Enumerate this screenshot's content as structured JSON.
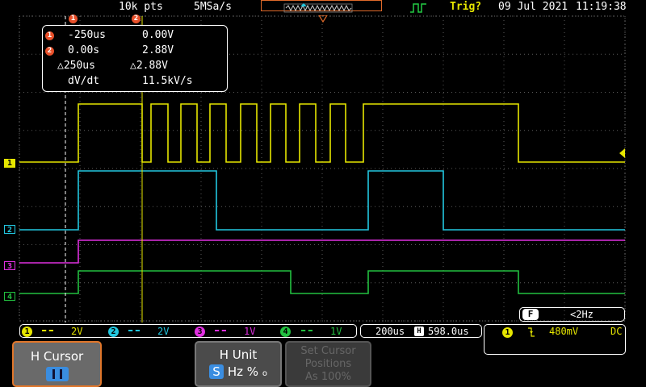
{
  "top": {
    "record_length": "10k pts",
    "sample_rate": "5MSa/s",
    "trigger_status": "Trig?",
    "date": "09 Jul 2021",
    "time": "11:19:38"
  },
  "cursor_readout": {
    "c1_marker": "1",
    "c2_marker": "2",
    "c1_time": "-250us",
    "c1_volt": "0.00V",
    "c2_time": "0.00s",
    "c2_volt": "2.88V",
    "delta_time": "△250us",
    "delta_volt": "△2.88V",
    "dvdt_label": "dV/dt",
    "dvdt_value": "11.5kV/s"
  },
  "channels": [
    {
      "id": "1",
      "scale": "2V",
      "color": "#e6e600"
    },
    {
      "id": "2",
      "scale": "2V",
      "color": "#22c7e0"
    },
    {
      "id": "3",
      "scale": "1V",
      "color": "#e030e0"
    },
    {
      "id": "4",
      "scale": "1V",
      "color": "#22c040"
    }
  ],
  "timebase": {
    "scale": "200us",
    "position_icon": "H",
    "position": "598.0us"
  },
  "trigger": {
    "source": "1",
    "slope_icon": "falling-edge-icon",
    "level": "480mV",
    "coupling": "DC"
  },
  "frequency": {
    "badge": "F",
    "value": "<2Hz"
  },
  "softkeys": {
    "hcursor_label": "H Cursor",
    "hunit_label": "H Unit",
    "hunit_s": "S",
    "hunit_hz": "Hz",
    "hunit_pct": "%",
    "hunit_deg": "o",
    "setcursor_line1": "Set Cursor",
    "setcursor_line2": "Positions",
    "setcursor_line3": "As 100%"
  }
}
